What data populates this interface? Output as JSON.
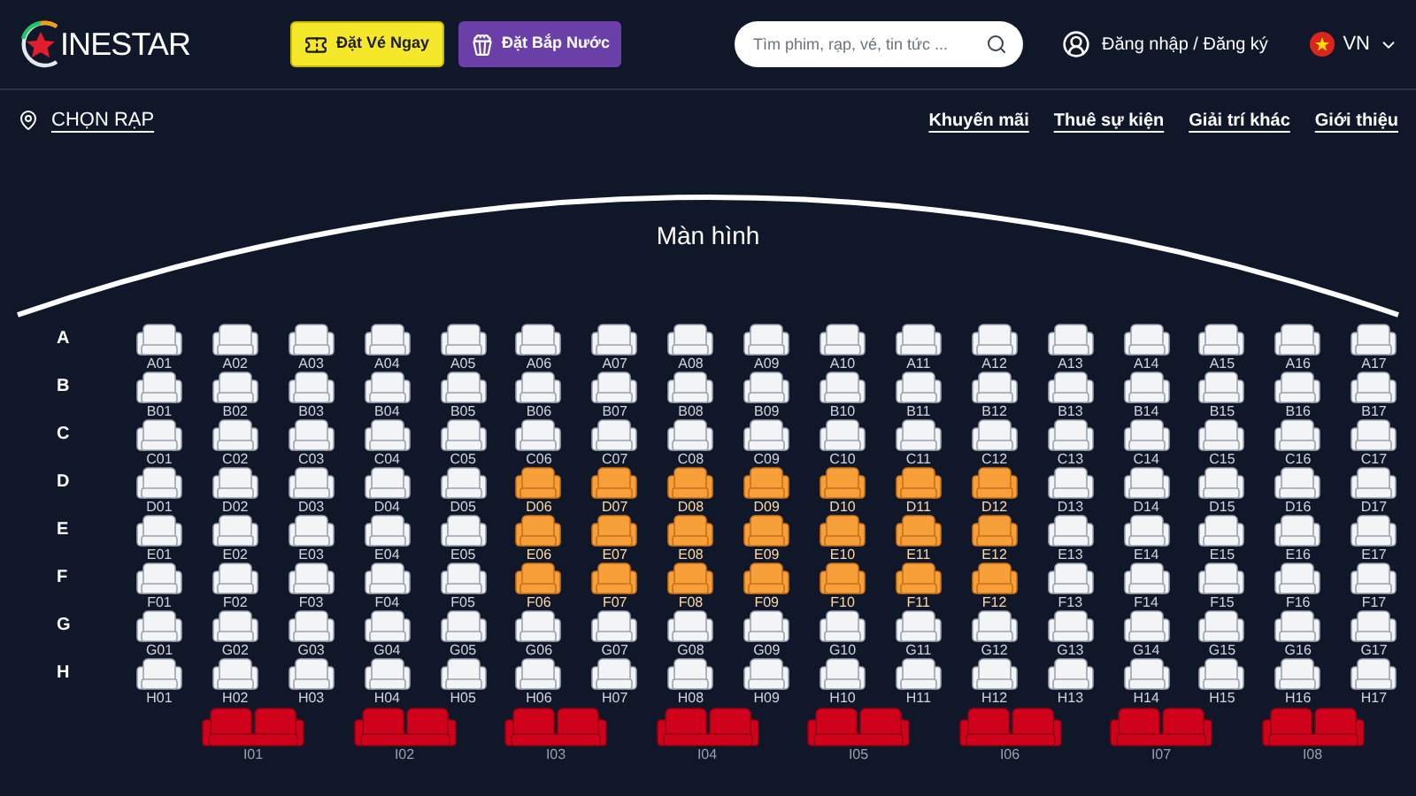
{
  "header": {
    "logo": "INESTAR",
    "buttons": [
      {
        "kind": "ticket",
        "label": "Đặt Vé Ngay"
      },
      {
        "kind": "popcorn",
        "label": "Đặt Bắp Nước"
      }
    ],
    "search": {
      "placeholder": "Tìm phim, rạp, vé, tin tức ..."
    },
    "account": "Đăng nhập / Đăng ký",
    "language": "VN"
  },
  "nav": {
    "cinema": "CHỌN RẠP",
    "links": [
      "Khuyến mãi",
      "Thuê sự kiện",
      "Giải trí khác",
      "Giới thiệu"
    ]
  },
  "screen": {
    "label": "Màn hình"
  },
  "rows": [
    {
      "letter": "A",
      "seats": [
        {
          "label": "A01",
          "selected": false
        },
        {
          "label": "A02",
          "selected": false
        },
        {
          "label": "A03",
          "selected": false
        },
        {
          "label": "A04",
          "selected": false
        },
        {
          "label": "A05",
          "selected": false
        },
        {
          "label": "A06",
          "selected": false
        },
        {
          "label": "A07",
          "selected": false
        },
        {
          "label": "A08",
          "selected": false
        },
        {
          "label": "A09",
          "selected": false
        },
        {
          "label": "A10",
          "selected": false
        },
        {
          "label": "A11",
          "selected": false
        },
        {
          "label": "A12",
          "selected": false
        },
        {
          "label": "A13",
          "selected": false
        },
        {
          "label": "A14",
          "selected": false
        },
        {
          "label": "A15",
          "selected": false
        },
        {
          "label": "A16",
          "selected": false
        },
        {
          "label": "A17",
          "selected": false
        }
      ]
    },
    {
      "letter": "B",
      "seats": [
        {
          "label": "B01",
          "selected": false
        },
        {
          "label": "B02",
          "selected": false
        },
        {
          "label": "B03",
          "selected": false
        },
        {
          "label": "B04",
          "selected": false
        },
        {
          "label": "B05",
          "selected": false
        },
        {
          "label": "B06",
          "selected": false
        },
        {
          "label": "B07",
          "selected": false
        },
        {
          "label": "B08",
          "selected": false
        },
        {
          "label": "B09",
          "selected": false
        },
        {
          "label": "B10",
          "selected": false
        },
        {
          "label": "B11",
          "selected": false
        },
        {
          "label": "B12",
          "selected": false
        },
        {
          "label": "B13",
          "selected": false
        },
        {
          "label": "B14",
          "selected": false
        },
        {
          "label": "B15",
          "selected": false
        },
        {
          "label": "B16",
          "selected": false
        },
        {
          "label": "B17",
          "selected": false
        }
      ]
    },
    {
      "letter": "C",
      "seats": [
        {
          "label": "C01",
          "selected": false
        },
        {
          "label": "C02",
          "selected": false
        },
        {
          "label": "C03",
          "selected": false
        },
        {
          "label": "C04",
          "selected": false
        },
        {
          "label": "C05",
          "selected": false
        },
        {
          "label": "C06",
          "selected": false
        },
        {
          "label": "C07",
          "selected": false
        },
        {
          "label": "C08",
          "selected": false
        },
        {
          "label": "C09",
          "selected": false
        },
        {
          "label": "C10",
          "selected": false
        },
        {
          "label": "C11",
          "selected": false
        },
        {
          "label": "C12",
          "selected": false
        },
        {
          "label": "C13",
          "selected": false
        },
        {
          "label": "C14",
          "selected": false
        },
        {
          "label": "C15",
          "selected": false
        },
        {
          "label": "C16",
          "selected": false
        },
        {
          "label": "C17",
          "selected": false
        }
      ]
    },
    {
      "letter": "D",
      "seats": [
        {
          "label": "D01",
          "selected": false
        },
        {
          "label": "D02",
          "selected": false
        },
        {
          "label": "D03",
          "selected": false
        },
        {
          "label": "D04",
          "selected": false
        },
        {
          "label": "D05",
          "selected": false
        },
        {
          "label": "D06",
          "selected": true
        },
        {
          "label": "D07",
          "selected": true
        },
        {
          "label": "D08",
          "selected": true
        },
        {
          "label": "D09",
          "selected": true
        },
        {
          "label": "D10",
          "selected": true
        },
        {
          "label": "D11",
          "selected": true
        },
        {
          "label": "D12",
          "selected": true
        },
        {
          "label": "D13",
          "selected": false
        },
        {
          "label": "D14",
          "selected": false
        },
        {
          "label": "D15",
          "selected": false
        },
        {
          "label": "D16",
          "selected": false
        },
        {
          "label": "D17",
          "selected": false
        }
      ]
    },
    {
      "letter": "E",
      "seats": [
        {
          "label": "E01",
          "selected": false
        },
        {
          "label": "E02",
          "selected": false
        },
        {
          "label": "E03",
          "selected": false
        },
        {
          "label": "E04",
          "selected": false
        },
        {
          "label": "E05",
          "selected": false
        },
        {
          "label": "E06",
          "selected": true
        },
        {
          "label": "E07",
          "selected": true
        },
        {
          "label": "E08",
          "selected": true
        },
        {
          "label": "E09",
          "selected": true
        },
        {
          "label": "E10",
          "selected": true
        },
        {
          "label": "E11",
          "selected": true
        },
        {
          "label": "E12",
          "selected": true
        },
        {
          "label": "E13",
          "selected": false
        },
        {
          "label": "E14",
          "selected": false
        },
        {
          "label": "E15",
          "selected": false
        },
        {
          "label": "E16",
          "selected": false
        },
        {
          "label": "E17",
          "selected": false
        }
      ]
    },
    {
      "letter": "F",
      "seats": [
        {
          "label": "F01",
          "selected": false
        },
        {
          "label": "F02",
          "selected": false
        },
        {
          "label": "F03",
          "selected": false
        },
        {
          "label": "F04",
          "selected": false
        },
        {
          "label": "F05",
          "selected": false
        },
        {
          "label": "F06",
          "selected": true
        },
        {
          "label": "F07",
          "selected": true
        },
        {
          "label": "F08",
          "selected": true
        },
        {
          "label": "F09",
          "selected": true
        },
        {
          "label": "F10",
          "selected": true
        },
        {
          "label": "F11",
          "selected": true
        },
        {
          "label": "F12",
          "selected": true
        },
        {
          "label": "F13",
          "selected": false
        },
        {
          "label": "F14",
          "selected": false
        },
        {
          "label": "F15",
          "selected": false
        },
        {
          "label": "F16",
          "selected": false
        },
        {
          "label": "F17",
          "selected": false
        }
      ]
    },
    {
      "letter": "G",
      "seats": [
        {
          "label": "G01",
          "selected": false
        },
        {
          "label": "G02",
          "selected": false
        },
        {
          "label": "G03",
          "selected": false
        },
        {
          "label": "G04",
          "selected": false
        },
        {
          "label": "G05",
          "selected": false
        },
        {
          "label": "G06",
          "selected": false
        },
        {
          "label": "G07",
          "selected": false
        },
        {
          "label": "G08",
          "selected": false
        },
        {
          "label": "G09",
          "selected": false
        },
        {
          "label": "G10",
          "selected": false
        },
        {
          "label": "G11",
          "selected": false
        },
        {
          "label": "G12",
          "selected": false
        },
        {
          "label": "G13",
          "selected": false
        },
        {
          "label": "G14",
          "selected": false
        },
        {
          "label": "G15",
          "selected": false
        },
        {
          "label": "G16",
          "selected": false
        },
        {
          "label": "G17",
          "selected": false
        }
      ]
    },
    {
      "letter": "H",
      "seats": [
        {
          "label": "H01",
          "selected": false
        },
        {
          "label": "H02",
          "selected": false
        },
        {
          "label": "H03",
          "selected": false
        },
        {
          "label": "H04",
          "selected": false
        },
        {
          "label": "H05",
          "selected": false
        },
        {
          "label": "H06",
          "selected": false
        },
        {
          "label": "H07",
          "selected": false
        },
        {
          "label": "H08",
          "selected": false
        },
        {
          "label": "H09",
          "selected": false
        },
        {
          "label": "H10",
          "selected": false
        },
        {
          "label": "H11",
          "selected": false
        },
        {
          "label": "H12",
          "selected": false
        },
        {
          "label": "H13",
          "selected": false
        },
        {
          "label": "H14",
          "selected": false
        },
        {
          "label": "H15",
          "selected": false
        },
        {
          "label": "H16",
          "selected": false
        },
        {
          "label": "H17",
          "selected": false
        }
      ]
    }
  ],
  "couple_seats": [
    {
      "label": "I01",
      "selected": false
    },
    {
      "label": "I02",
      "selected": false
    },
    {
      "label": "I03",
      "selected": false
    },
    {
      "label": "I04",
      "selected": false
    },
    {
      "label": "I05",
      "selected": false
    },
    {
      "label": "I06",
      "selected": false
    },
    {
      "label": "I07",
      "selected": false
    },
    {
      "label": "I08",
      "selected": false
    }
  ]
}
